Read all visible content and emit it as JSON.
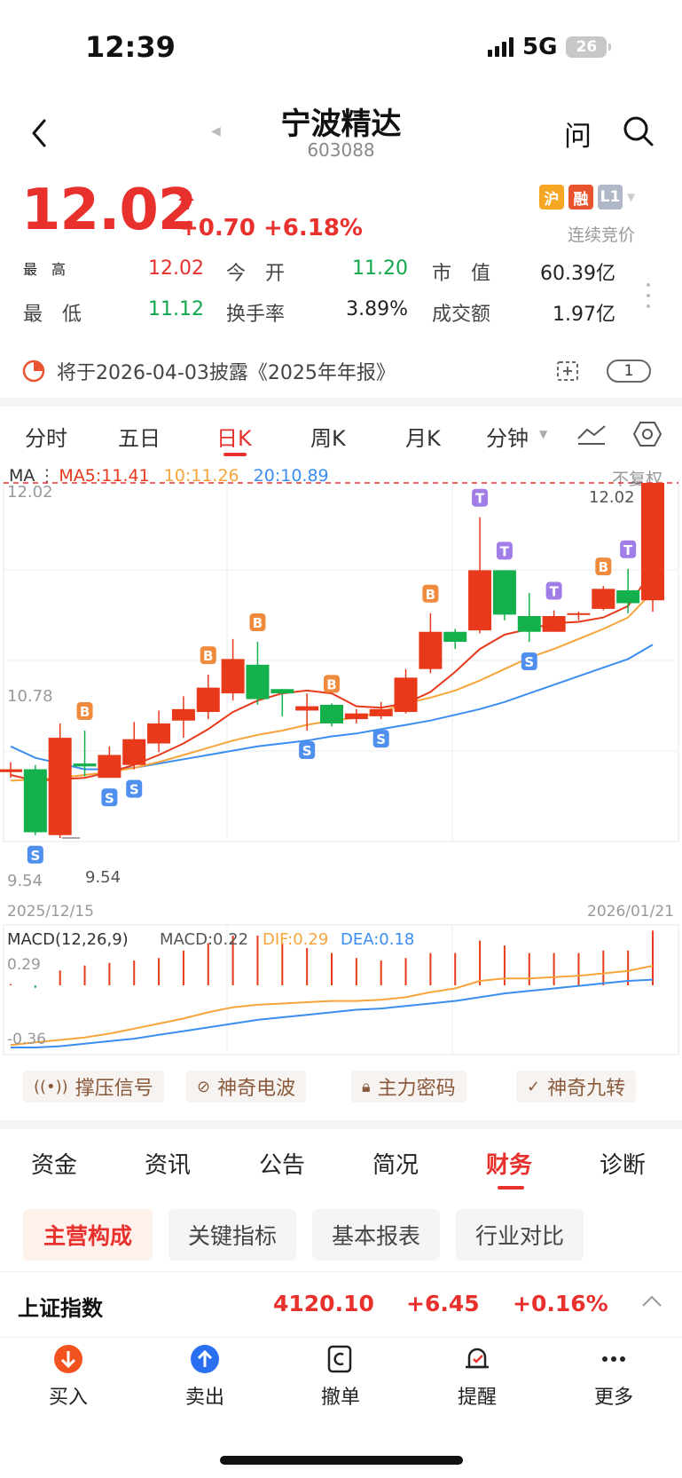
{
  "status": {
    "time": "12:39",
    "network": "5G",
    "battery": "26"
  },
  "header": {
    "name": "宁波精达",
    "code": "603088",
    "ask_label": "问"
  },
  "quote": {
    "price": "12.02",
    "change": "+0.70 +6.18%",
    "badges": [
      "沪",
      "融",
      "L1"
    ],
    "badge_colors": [
      "#f5a623",
      "#e8542d",
      "#b0b8c8"
    ],
    "bid_status": "连续竞价",
    "stats": [
      {
        "label": "最　高",
        "value": "12.02",
        "color": "#e8312d"
      },
      {
        "label": "今　开",
        "value": "11.20",
        "color": "#12a84d"
      },
      {
        "label": "市　值",
        "value": "60.39亿",
        "color": "#222222"
      },
      {
        "label": "最　低",
        "value": "11.12",
        "color": "#12a84d"
      },
      {
        "label": "换手率",
        "value": "3.89%",
        "color": "#222222"
      },
      {
        "label": "成交额",
        "value": "1.97亿",
        "color": "#222222"
      }
    ]
  },
  "notice": {
    "text": "将于2026-04-03披露《2025年年报》",
    "count": "1"
  },
  "kline_tabs": [
    "分时",
    "五日",
    "日K",
    "周K",
    "月K",
    "分钟"
  ],
  "active_tab": "日K",
  "ma": {
    "prefix": "MA",
    "ma5": "MA5:11.41",
    "ma10": "10:11.26",
    "ma20": "20:10.89",
    "restore": "不复权"
  },
  "chart_labels": {
    "y_top": "12.02",
    "y_mid": "10.78",
    "y_bottom": "9.54",
    "high_marker": "12.02",
    "low_marker": "9.54",
    "date_start": "2025/12/15",
    "date_end": "2026/01/21"
  },
  "macd": {
    "title": "MACD(12,26,9)",
    "macd": "MACD:0.22",
    "dif": "DIF:0.29",
    "dea": "DEA:0.18",
    "y_top": "0.29",
    "y_bottom": "-0.36"
  },
  "chart_data": {
    "type": "candlestick",
    "ylim": [
      9.54,
      12.02
    ],
    "x_start": "2025/12/15",
    "x_end": "2026/01/21",
    "candles": [
      {
        "o": 10.0,
        "h": 10.07,
        "l": 9.96,
        "c": 10.02,
        "sig": ""
      },
      {
        "o": 10.02,
        "h": 10.05,
        "l": 9.56,
        "c": 9.58,
        "sig": "S"
      },
      {
        "o": 9.56,
        "h": 10.34,
        "l": 9.54,
        "c": 10.24,
        "sig": ""
      },
      {
        "o": 10.06,
        "h": 10.29,
        "l": 9.97,
        "c": 10.04,
        "sig": "B"
      },
      {
        "o": 9.96,
        "h": 10.18,
        "l": 9.96,
        "c": 10.12,
        "sig": "S"
      },
      {
        "o": 10.05,
        "h": 10.35,
        "l": 10.02,
        "c": 10.23,
        "sig": "S"
      },
      {
        "o": 10.2,
        "h": 10.43,
        "l": 10.14,
        "c": 10.34,
        "sig": ""
      },
      {
        "o": 10.36,
        "h": 10.53,
        "l": 10.24,
        "c": 10.44,
        "sig": ""
      },
      {
        "o": 10.42,
        "h": 10.68,
        "l": 10.37,
        "c": 10.59,
        "sig": "B"
      },
      {
        "o": 10.55,
        "h": 10.93,
        "l": 10.5,
        "c": 10.79,
        "sig": ""
      },
      {
        "o": 10.75,
        "h": 10.91,
        "l": 10.47,
        "c": 10.51,
        "sig": "B"
      },
      {
        "o": 10.58,
        "h": 10.58,
        "l": 10.39,
        "c": 10.55,
        "sig": ""
      },
      {
        "o": 10.43,
        "h": 10.55,
        "l": 10.29,
        "c": 10.46,
        "sig": "S"
      },
      {
        "o": 10.47,
        "h": 10.48,
        "l": 10.32,
        "c": 10.34,
        "sig": "B"
      },
      {
        "o": 10.37,
        "h": 10.44,
        "l": 10.34,
        "c": 10.41,
        "sig": ""
      },
      {
        "o": 10.39,
        "h": 10.49,
        "l": 10.37,
        "c": 10.44,
        "sig": "S"
      },
      {
        "o": 10.42,
        "h": 10.72,
        "l": 10.41,
        "c": 10.66,
        "sig": ""
      },
      {
        "o": 10.72,
        "h": 11.11,
        "l": 10.69,
        "c": 10.98,
        "sig": "B"
      },
      {
        "o": 10.98,
        "h": 11.0,
        "l": 10.86,
        "c": 10.91,
        "sig": ""
      },
      {
        "o": 10.99,
        "h": 11.78,
        "l": 10.97,
        "c": 11.41,
        "sig": "T"
      },
      {
        "o": 11.41,
        "h": 11.41,
        "l": 11.06,
        "c": 11.1,
        "sig": "T"
      },
      {
        "o": 11.09,
        "h": 11.25,
        "l": 10.91,
        "c": 10.98,
        "sig": "S"
      },
      {
        "o": 10.98,
        "h": 11.13,
        "l": 10.98,
        "c": 11.09,
        "sig": "T"
      },
      {
        "o": 11.1,
        "h": 11.12,
        "l": 11.06,
        "c": 11.11,
        "sig": ""
      },
      {
        "o": 11.14,
        "h": 11.3,
        "l": 11.13,
        "c": 11.28,
        "sig": "B"
      },
      {
        "o": 11.27,
        "h": 11.42,
        "l": 11.11,
        "c": 11.18,
        "sig": "T"
      },
      {
        "o": 11.2,
        "h": 12.02,
        "l": 11.12,
        "c": 12.02,
        "sig": ""
      }
    ],
    "ma5": [
      9.98,
      9.94,
      9.95,
      9.96,
      10.0,
      10.05,
      10.12,
      10.2,
      10.3,
      10.42,
      10.5,
      10.55,
      10.57,
      10.55,
      10.46,
      10.45,
      10.48,
      10.56,
      10.7,
      10.86,
      10.96,
      11.0,
      11.04,
      11.05,
      11.08,
      11.16,
      11.41
    ],
    "ma10": [
      9.94,
      9.95,
      9.96,
      9.98,
      10.0,
      10.03,
      10.07,
      10.12,
      10.17,
      10.22,
      10.26,
      10.29,
      10.33,
      10.36,
      10.38,
      10.42,
      10.48,
      10.52,
      10.57,
      10.64,
      10.72,
      10.8,
      10.86,
      10.93,
      11.0,
      11.08,
      11.26
    ],
    "ma20": [
      10.18,
      10.1,
      10.06,
      10.02,
      10.02,
      10.03,
      10.06,
      10.09,
      10.12,
      10.15,
      10.18,
      10.2,
      10.22,
      10.25,
      10.27,
      10.3,
      10.33,
      10.36,
      10.4,
      10.44,
      10.49,
      10.55,
      10.61,
      10.67,
      10.73,
      10.79,
      10.89
    ],
    "macd_ylim": [
      -0.36,
      0.29
    ],
    "macd_hist": [
      0.005,
      -0.01,
      0.06,
      0.08,
      0.09,
      0.1,
      0.11,
      0.14,
      0.17,
      0.2,
      0.2,
      0.17,
      0.15,
      0.13,
      0.11,
      0.1,
      0.11,
      0.13,
      0.13,
      0.18,
      0.16,
      0.13,
      0.13,
      0.13,
      0.14,
      0.14,
      0.22
    ],
    "dif": [
      -0.34,
      -0.32,
      -0.3,
      -0.28,
      -0.25,
      -0.21,
      -0.17,
      -0.13,
      -0.08,
      -0.04,
      -0.02,
      -0.01,
      -0.0,
      0.01,
      0.01,
      0.02,
      0.04,
      0.08,
      0.11,
      0.17,
      0.19,
      0.19,
      0.2,
      0.21,
      0.23,
      0.25,
      0.29
    ],
    "dea": [
      -0.36,
      -0.36,
      -0.35,
      -0.33,
      -0.31,
      -0.29,
      -0.26,
      -0.23,
      -0.2,
      -0.17,
      -0.14,
      -0.12,
      -0.1,
      -0.08,
      -0.06,
      -0.05,
      -0.03,
      -0.01,
      0.01,
      0.04,
      0.07,
      0.09,
      0.11,
      0.13,
      0.15,
      0.17,
      0.18
    ],
    "colors": {
      "up": "#e8391b",
      "down": "#13b04b",
      "ma5": "#e8391b",
      "ma10": "#f7a43a",
      "ma20": "#3b8ef0",
      "buy": "#f08a3c",
      "sell": "#4e8fef",
      "top": "#a17de8"
    }
  },
  "indicator_buttons": [
    "撑压信号",
    "神奇电波",
    "主力密码",
    "神奇九转"
  ],
  "bottom_tabs": [
    "资金",
    "资讯",
    "公告",
    "简况",
    "财务",
    "诊断"
  ],
  "active_bottom_tab": "财务",
  "sub_tabs": [
    "主营构成",
    "关键指标",
    "基本报表",
    "行业对比"
  ],
  "index_bar": {
    "name": "上证指数",
    "value": "4120.10",
    "change": "+6.45",
    "pct": "+0.16%"
  },
  "actions": [
    "买入",
    "卖出",
    "撤单",
    "提醒",
    "更多"
  ]
}
